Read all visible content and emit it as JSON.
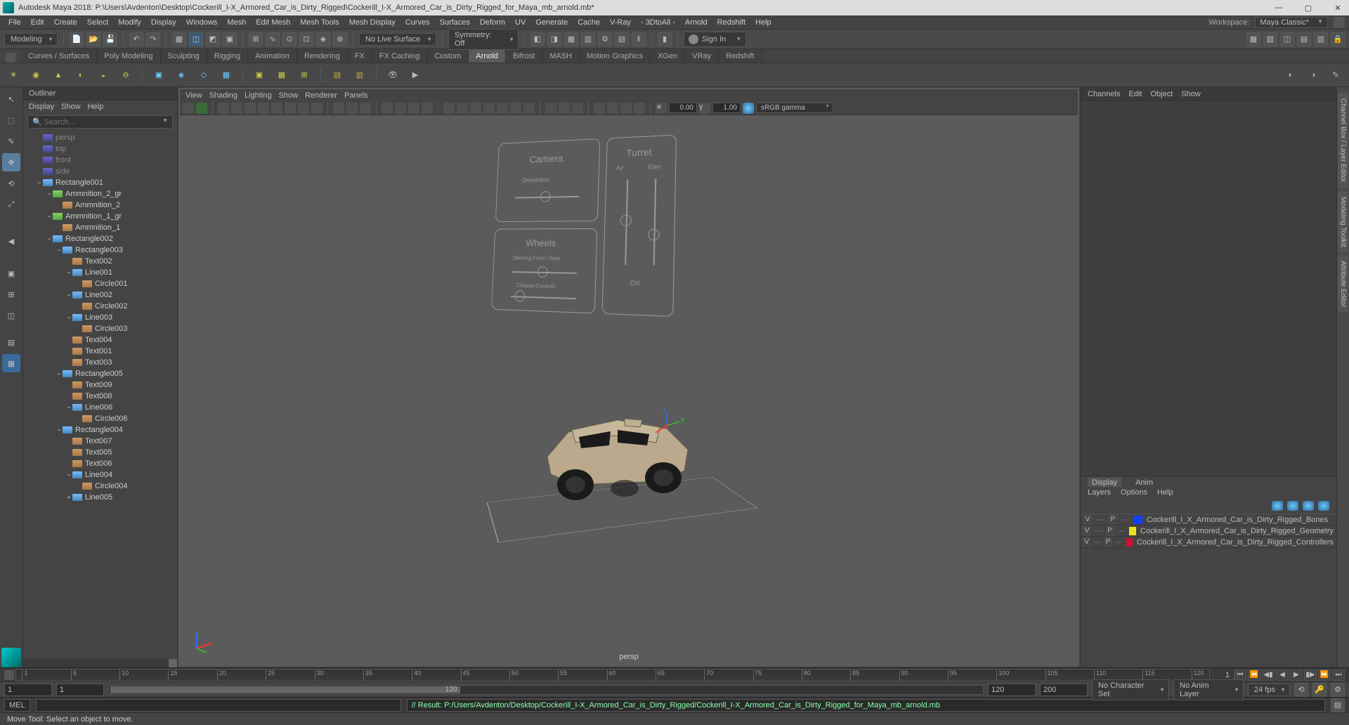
{
  "titlebar": {
    "title": "Autodesk Maya 2018: P:\\Users\\Avdenton\\Desktop\\Cockerill_I-X_Armored_Car_is_Dirty_Rigged\\Cockerill_I-X_Armored_Car_is_Dirty_Rigged_for_Maya_mb_arnold.mb*"
  },
  "menubar": {
    "items": [
      "File",
      "Edit",
      "Create",
      "Select",
      "Modify",
      "Display",
      "Windows",
      "Mesh",
      "Edit Mesh",
      "Mesh Tools",
      "Mesh Display",
      "Curves",
      "Surfaces",
      "Deform",
      "UV",
      "Generate",
      "Cache",
      "V-Ray",
      "- 3DtoAll -",
      "Arnold",
      "Redshift",
      "Help"
    ],
    "workspace_label": "Workspace:",
    "workspace_value": "Maya Classic*"
  },
  "shelf_top": {
    "mode": "Modeling",
    "live_surface": "No Live Surface",
    "symmetry": "Symmetry: Off",
    "signin": "Sign In"
  },
  "shelf_tabs": [
    "Curves / Surfaces",
    "Poly Modeling",
    "Sculpting",
    "Rigging",
    "Animation",
    "Rendering",
    "FX",
    "FX Caching",
    "Custom",
    "Arnold",
    "Bifrost",
    "MASH",
    "Motion Graphics",
    "XGen",
    "VRay",
    "Redshift"
  ],
  "shelf_tabs_active": "Arnold",
  "outliner": {
    "title": "Outliner",
    "menu": [
      "Display",
      "Show",
      "Help"
    ],
    "search_placeholder": "Search...",
    "nodes": [
      {
        "d": 1,
        "t": "cam",
        "l": "persp",
        "dim": true,
        "tw": ""
      },
      {
        "d": 1,
        "t": "cam",
        "l": "top",
        "dim": true,
        "tw": ""
      },
      {
        "d": 1,
        "t": "cam",
        "l": "front",
        "dim": true,
        "tw": ""
      },
      {
        "d": 1,
        "t": "cam",
        "l": "side",
        "dim": true,
        "tw": ""
      },
      {
        "d": 1,
        "t": "xf",
        "l": "Rectangle001",
        "tw": "−"
      },
      {
        "d": 2,
        "t": "grp",
        "l": "Ammnition_2_gr",
        "tw": "−"
      },
      {
        "d": 3,
        "t": "sh",
        "l": "Ammnition_2",
        "tw": ""
      },
      {
        "d": 2,
        "t": "grp",
        "l": "Ammnition_1_gr",
        "tw": "−"
      },
      {
        "d": 3,
        "t": "sh",
        "l": "Ammnition_1",
        "tw": ""
      },
      {
        "d": 2,
        "t": "xf",
        "l": "Rectangle002",
        "tw": "−"
      },
      {
        "d": 3,
        "t": "xf",
        "l": "Rectangle003",
        "tw": "−"
      },
      {
        "d": 4,
        "t": "sh",
        "l": "Text002",
        "tw": ""
      },
      {
        "d": 4,
        "t": "xf",
        "l": "Line001",
        "tw": "−"
      },
      {
        "d": 5,
        "t": "sh",
        "l": "Circle001",
        "tw": ""
      },
      {
        "d": 4,
        "t": "xf",
        "l": "Line002",
        "tw": "−"
      },
      {
        "d": 5,
        "t": "sh",
        "l": "Circle002",
        "tw": ""
      },
      {
        "d": 4,
        "t": "xf",
        "l": "Line003",
        "tw": "−"
      },
      {
        "d": 5,
        "t": "sh",
        "l": "Circle003",
        "tw": ""
      },
      {
        "d": 4,
        "t": "sh",
        "l": "Text004",
        "tw": ""
      },
      {
        "d": 4,
        "t": "sh",
        "l": "Text001",
        "tw": ""
      },
      {
        "d": 4,
        "t": "sh",
        "l": "Text003",
        "tw": ""
      },
      {
        "d": 3,
        "t": "xf",
        "l": "Rectangle005",
        "tw": "−"
      },
      {
        "d": 4,
        "t": "sh",
        "l": "Text009",
        "tw": ""
      },
      {
        "d": 4,
        "t": "sh",
        "l": "Text008",
        "tw": ""
      },
      {
        "d": 4,
        "t": "xf",
        "l": "Line006",
        "tw": "−"
      },
      {
        "d": 5,
        "t": "sh",
        "l": "Circle006",
        "tw": ""
      },
      {
        "d": 3,
        "t": "xf",
        "l": "Rectangle004",
        "tw": "−"
      },
      {
        "d": 4,
        "t": "sh",
        "l": "Text007",
        "tw": ""
      },
      {
        "d": 4,
        "t": "sh",
        "l": "Text005",
        "tw": ""
      },
      {
        "d": 4,
        "t": "sh",
        "l": "Text006",
        "tw": ""
      },
      {
        "d": 4,
        "t": "xf",
        "l": "Line004",
        "tw": "−"
      },
      {
        "d": 5,
        "t": "sh",
        "l": "Circle004",
        "tw": ""
      },
      {
        "d": 4,
        "t": "xf",
        "l": "Line005",
        "tw": "+"
      }
    ]
  },
  "viewport": {
    "menu": [
      "View",
      "Shading",
      "Lighting",
      "Show",
      "Renderer",
      "Panels"
    ],
    "val1": "0.00",
    "val2": "1.00",
    "gamma": "sRGB gamma",
    "label": "persp",
    "rig": {
      "camera": "Camera",
      "turret": "Turret",
      "wheels": "Wheels",
      "orient": "Orientation",
      "steer": "Steering Front / Rear",
      "chassis": "Chassis Controls",
      "az": "Az",
      "elev": "Elev",
      "ctrl": "Ctrl"
    }
  },
  "rightpane": {
    "tabs1": [
      "Channels",
      "Edit",
      "Object",
      "Show"
    ],
    "tabs2": [
      "Display",
      "Anim"
    ],
    "tabs2_active": "Display",
    "lmenu": [
      "Layers",
      "Options",
      "Help"
    ],
    "layers": [
      {
        "v": "V",
        "p": "P",
        "c": "#1040ff",
        "n": "Cockerill_I_X_Armored_Car_is_Dirty_Rigged_Bones"
      },
      {
        "v": "V",
        "p": "P",
        "c": "#f0e020",
        "n": "Cockerill_I_X_Armored_Car_is_Dirty_Rigged_Geometry"
      },
      {
        "v": "V",
        "p": "P",
        "c": "#d01030",
        "n": "Cockerill_I_X_Armored_Car_is_Dirty_Rigged_Controllers"
      }
    ],
    "sidetabs": [
      "Channel Box / Layer Editor",
      "Modeling Toolkit",
      "Attribute Editor"
    ]
  },
  "timeline": {
    "ticks": [
      "1",
      "5",
      "10",
      "15",
      "20",
      "25",
      "30",
      "35",
      "40",
      "45",
      "50",
      "55",
      "60",
      "65",
      "70",
      "75",
      "80",
      "85",
      "90",
      "95",
      "100",
      "105",
      "110",
      "115",
      "120"
    ],
    "endframe": "1"
  },
  "range": {
    "start": "1",
    "startvis": "1",
    "endvis": "120",
    "end": "120",
    "end2": "200",
    "charset": "No Character Set",
    "animlayer": "No Anim Layer",
    "fps": "24 fps"
  },
  "cmd": {
    "lang": "MEL",
    "output": "// Result: P:/Users/Avdenton/Desktop/Cockerill_I-X_Armored_Car_is_Dirty_Rigged/Cockerill_I-X_Armored_Car_is_Dirty_Rigged_for_Maya_mb_arnold.mb"
  },
  "status": "Move Tool: Select an object to move.",
  "rangebar_label": "120"
}
